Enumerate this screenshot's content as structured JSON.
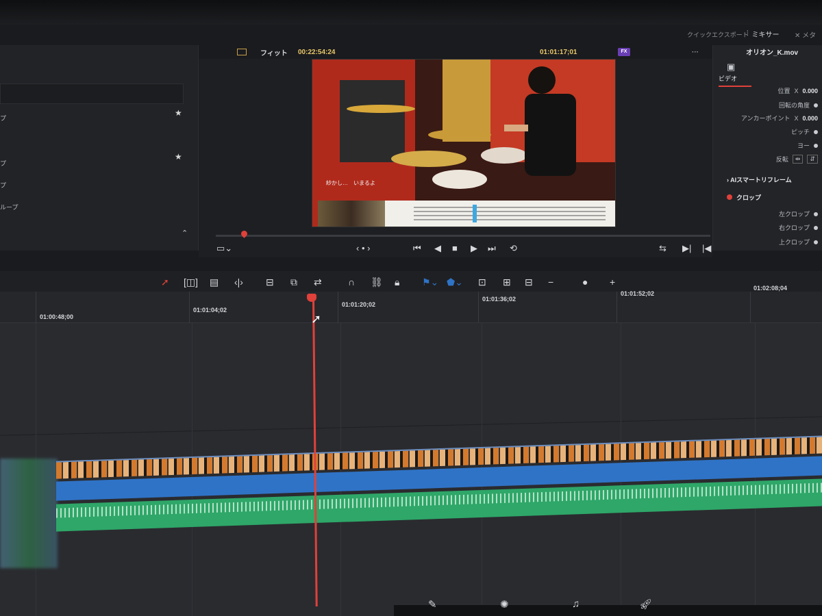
{
  "topbar": {
    "quick_export": "クイックエクスポート",
    "mixer": "ミキサー",
    "meta": "メタ"
  },
  "left_panel": {
    "items": [
      "プ",
      "プ",
      "プ",
      "ループ"
    ]
  },
  "viewer": {
    "zoom_label": "フィット",
    "source_timecode": "00:22:54:24",
    "record_timecode": "01:01:17;01",
    "fx_badge": "FX",
    "more": "···",
    "subtitle": "紗かし…　いまるよ"
  },
  "inspector": {
    "clip_name": "オリオン_K.mov",
    "tab_video": "ビデオ",
    "position_label": "位置",
    "position_axis": "X",
    "position_x": "0.000",
    "rotation_label": "回転の角度",
    "anchor_label": "アンカーポイント",
    "anchor_axis": "X",
    "anchor_x": "0.000",
    "pitch_label": "ピッチ",
    "yaw_label": "ヨー",
    "flip_label": "反転",
    "ai_reframe": "AIスマートリフレーム",
    "crop": "クロップ",
    "crop_left": "左クロップ",
    "crop_right": "右クロップ",
    "crop_top": "上クロップ"
  },
  "timeline": {
    "ruler_labels": [
      "01:00:48;00",
      "01:01:04;02",
      "01:01:20;02",
      "01:01:36;02",
      "01:01:52;02",
      "01:02:08;04"
    ]
  },
  "colors": {
    "accent_red": "#e0413a",
    "timecode_yellow": "#e8c76a",
    "clip_blue": "#2f73c6",
    "clip_green": "#2ea768"
  },
  "icons": {
    "transport": [
      "skip-back-icon",
      "play-reverse-icon",
      "stop-icon",
      "play-icon",
      "skip-forward-icon",
      "loop-icon"
    ],
    "timeline_tools": [
      "select-tool-icon",
      "trim-tool-icon",
      "dynamic-trim-icon",
      "blade-icon",
      "insert-icon",
      "overwrite-icon",
      "replace-icon",
      "snapping-icon",
      "link-icon",
      "lock-icon",
      "flag-icon",
      "marker-icon",
      "zoom-full-icon",
      "zoom-detail-icon",
      "zoom-custom-icon"
    ],
    "bottom_nav": [
      "fusion-icon",
      "color-icon",
      "fairlight-icon",
      "deliver-icon"
    ]
  }
}
